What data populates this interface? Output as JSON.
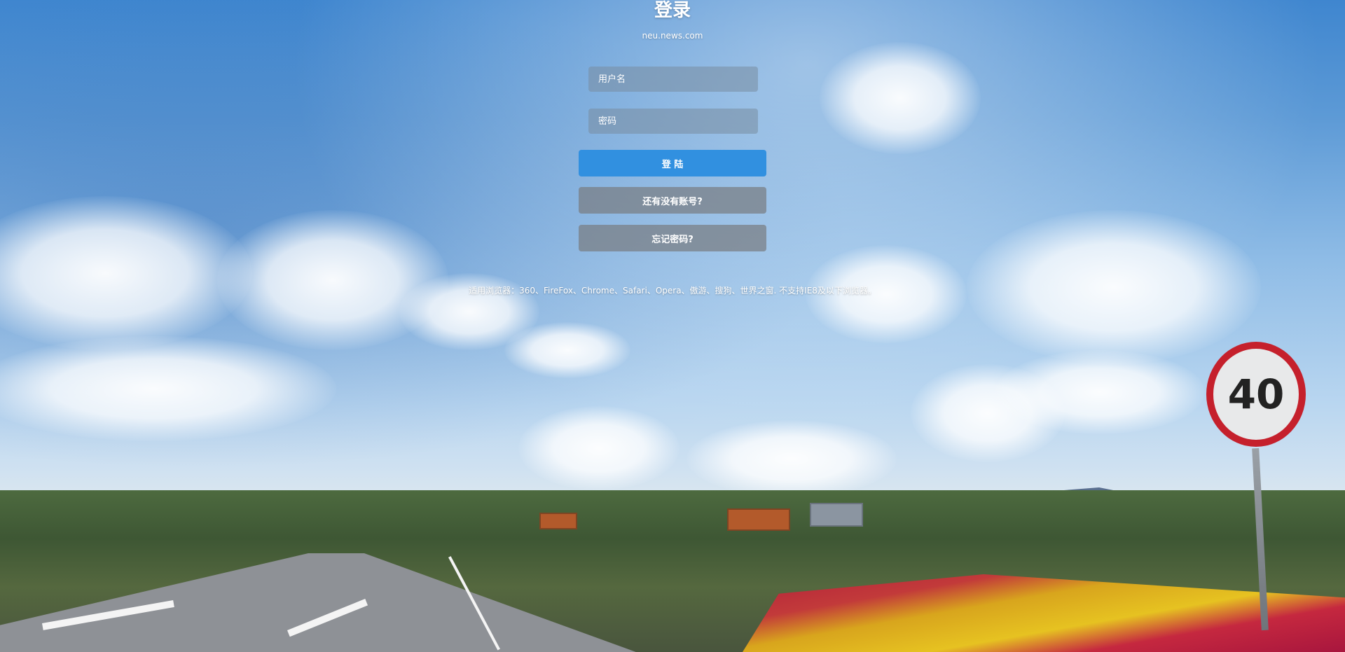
{
  "header": {
    "title": "登录",
    "site": "neu.news.com"
  },
  "form": {
    "username_placeholder": "用户名",
    "password_placeholder": "密码",
    "login_label": "登 陆",
    "register_label": "还有没有账号?",
    "forgot_label": "忘记密码?"
  },
  "footer": {
    "browser_note": "适用浏览器：360、FireFox、Chrome、Safari、Opera、傲游、搜狗、世界之窗. 不支持IE8及以下浏览器。"
  },
  "background": {
    "speed_sign_value": "40"
  },
  "colors": {
    "primary_button": "#3190e0",
    "secondary_button": "#787d82",
    "text": "#ffffff"
  }
}
